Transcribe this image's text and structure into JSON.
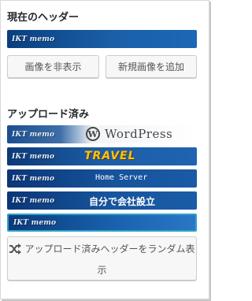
{
  "current_header": {
    "title": "現在のヘッダー",
    "strip_label": "IKT memo"
  },
  "buttons": {
    "hide_image": "画像を非表示",
    "add_new_image": "新規画像を追加"
  },
  "uploaded": {
    "title": "アップロード済み",
    "items": [
      {
        "strip_label": "IKT memo",
        "logo_text": "WordPress",
        "badge": "W"
      },
      {
        "strip_label": "IKT memo",
        "logo_text": "TRAVEL"
      },
      {
        "strip_label": "IKT memo",
        "logo_text": "Home Server"
      },
      {
        "strip_label": "IKT memo",
        "logo_text": "自分で会社設立"
      },
      {
        "strip_label": "IKT memo"
      }
    ]
  },
  "random_button": {
    "label": "アップロード済みヘッダーをランダム表示",
    "icon": "shuffle-icon"
  },
  "colors": {
    "accent_border": "#2ea2cc",
    "header_blue_dark": "#0a3f7e",
    "header_blue_light": "#1d67b5",
    "travel_gold": "#f5c518"
  }
}
